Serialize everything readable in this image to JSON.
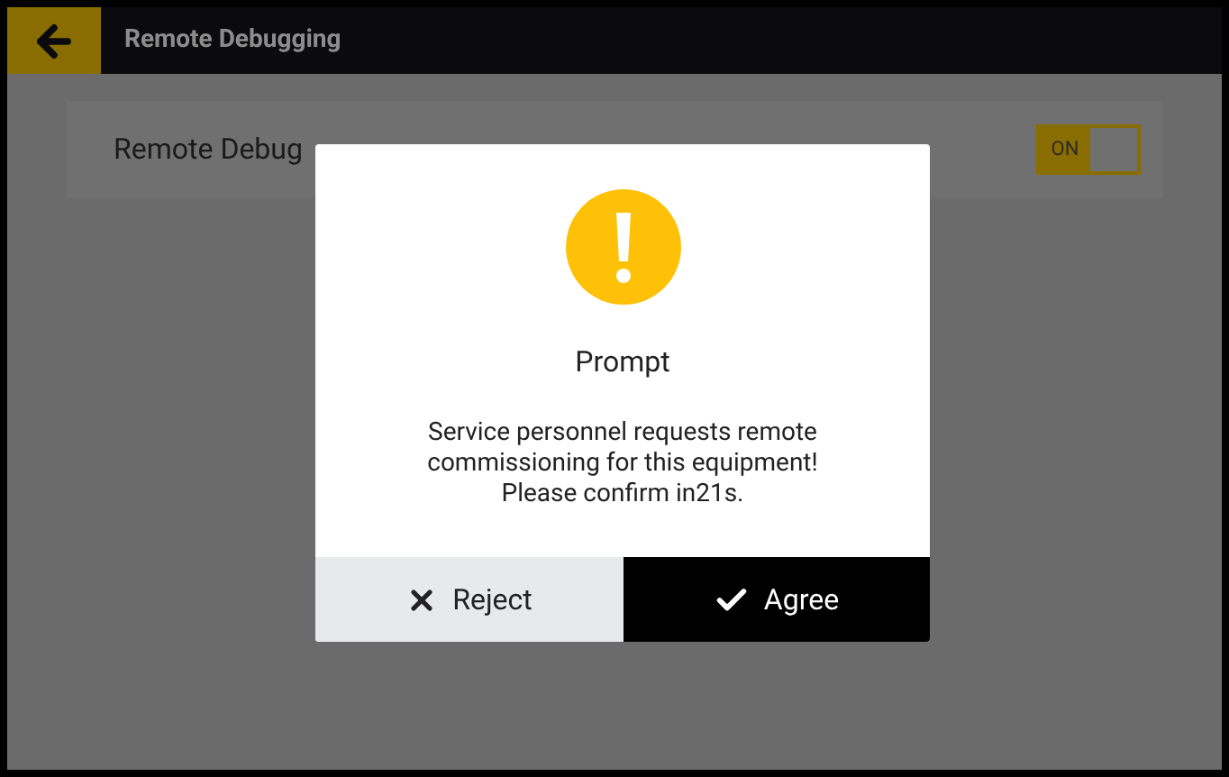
{
  "header": {
    "title": "Remote Debugging"
  },
  "setting": {
    "label": "Remote Debug",
    "toggle": {
      "on": true,
      "label": "ON"
    }
  },
  "dialog": {
    "title": "Prompt",
    "message": [
      "Service personnel requests remote",
      "commissioning for this equipment!",
      "Please confirm in21s."
    ],
    "buttons": [
      {
        "kind": "reject",
        "label": "Reject"
      },
      {
        "kind": "agree",
        "label": "Agree"
      }
    ]
  }
}
